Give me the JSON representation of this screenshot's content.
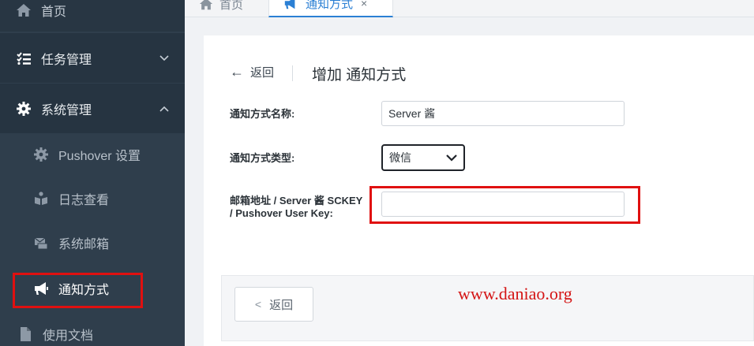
{
  "sidebar": {
    "home": {
      "label": "首页",
      "icon": "home-icon"
    },
    "task_mgmt": {
      "label": "任务管理",
      "icon": "list-icon"
    },
    "system_mgmt": {
      "label": "系统管理",
      "icon": "gear-icon"
    },
    "sub_items": [
      {
        "label": "Pushover 设置",
        "icon": "gear-icon"
      },
      {
        "label": "日志查看",
        "icon": "book-icon"
      },
      {
        "label": "系统邮箱",
        "icon": "mail-icon"
      },
      {
        "label": "通知方式",
        "icon": "megaphone-icon"
      }
    ],
    "docs": {
      "label": "使用文档",
      "icon": "file-icon"
    }
  },
  "tabs": {
    "home_label": "首页",
    "active_label": "通知方式",
    "close_glyph": "×"
  },
  "header": {
    "back_label": "返回",
    "title": "增加 通知方式"
  },
  "form": {
    "name_label": "通知方式名称:",
    "name_value": "Server 酱",
    "type_label": "通知方式类型:",
    "type_value": "微信",
    "key_label": "邮箱地址 / Server 酱 SCKEY / Pushover User Key:",
    "key_value": ""
  },
  "footer": {
    "back_label": "返回"
  },
  "watermark": "www.daniao.org",
  "colors": {
    "sidebar_bg": "#2f3e4c",
    "accent": "#2a7fd4",
    "highlight_red": "#e01010"
  }
}
